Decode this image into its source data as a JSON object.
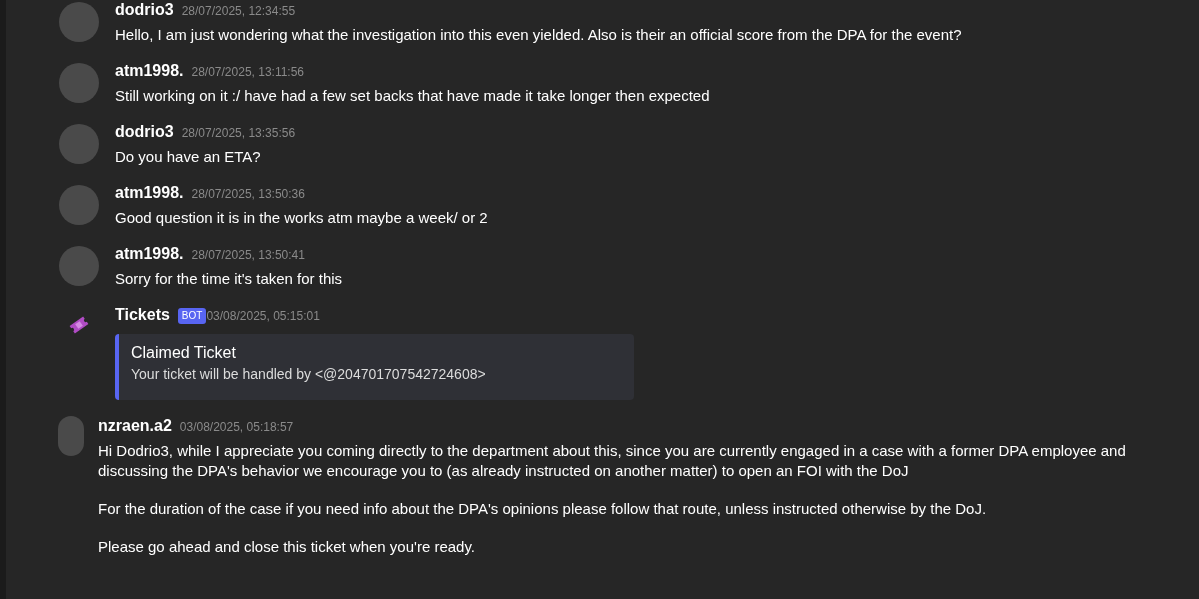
{
  "messages": [
    {
      "kind": "user",
      "author": "dodrio3",
      "time": "28/07/2025, 12:34:55",
      "paragraphs": [
        "Hello, I am just wondering what the investigation into this even yielded. Also is their an official score from the DPA for the event?"
      ]
    },
    {
      "kind": "user",
      "author": "atm1998.",
      "time": "28/07/2025, 13:11:56",
      "paragraphs": [
        "Still working on it :/ have had a few set backs that have made it take longer then expected"
      ]
    },
    {
      "kind": "user",
      "author": "dodrio3",
      "time": "28/07/2025, 13:35:56",
      "paragraphs": [
        "Do you have an ETA?"
      ]
    },
    {
      "kind": "user",
      "author": "atm1998.",
      "time": "28/07/2025, 13:50:36",
      "paragraphs": [
        "Good question it is in the works atm maybe a week/ or 2"
      ]
    },
    {
      "kind": "user",
      "author": "atm1998.",
      "time": "28/07/2025, 13:50:41",
      "paragraphs": [
        "Sorry for the time it's taken for this"
      ]
    },
    {
      "kind": "bot",
      "author": "Tickets",
      "badge": "BOT",
      "time": "03/08/2025, 05:15:01",
      "embed": {
        "title": "Claimed Ticket",
        "description": "Your ticket will be handled by <@204701707542724608>"
      }
    },
    {
      "kind": "narrow",
      "author": "nzraen.a2",
      "time": "03/08/2025, 05:18:57",
      "paragraphs": [
        "Hi Dodrio3, while I appreciate you coming directly to the department about this, since you are currently engaged in a case with a former DPA employee and discussing the DPA's behavior we encourage you to (as already instructed on another matter) to open an FOI with the DoJ",
        "For the duration of the case if you need info about the DPA's opinions please follow that route, unless instructed otherwise by the DoJ.",
        "Please go ahead and close this ticket when you're ready."
      ]
    }
  ]
}
